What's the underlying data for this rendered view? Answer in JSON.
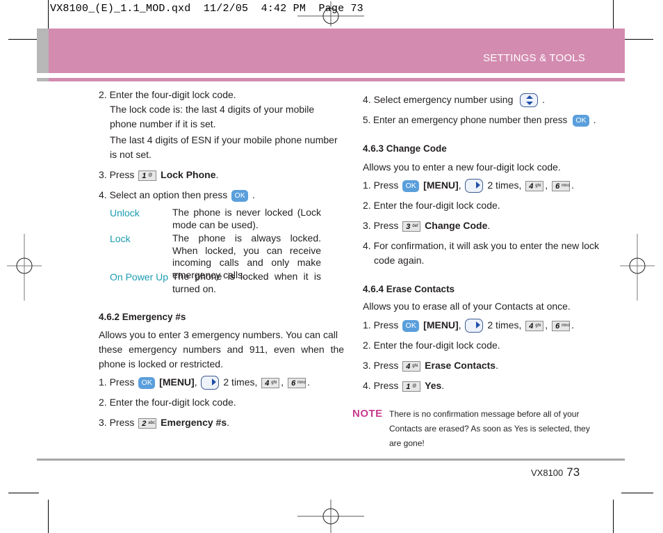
{
  "slug": "VX8100_(E)_1.1_MOD.qxd  11/2/05  4:42 PM  Page 73",
  "header": {
    "section_title": "SETTINGS & TOOLS",
    "accent_color": "#d38bb0",
    "sidebar_color": "#b8b7b7"
  },
  "left": {
    "step2": {
      "num": "2.",
      "text": "Enter the four-digit lock code.",
      "note1a": "The lock code is: the last 4 digits of your mobile",
      "note1b": "phone number if it is set.",
      "note2a": "The last 4 digits of ESN if your mobile phone number",
      "note2b": "is not set."
    },
    "step3": {
      "num": "3.",
      "press": "Press",
      "key": "1",
      "key_sub": "@",
      "label": "Lock Phone",
      "end": "."
    },
    "step4": {
      "num": "4.",
      "text": "Select an option then press",
      "ok": "OK",
      "end": "."
    },
    "options": [
      {
        "name": "Unlock",
        "desc": "The phone is never locked (Lock mode can be used)."
      },
      {
        "name": "Lock",
        "desc": "The phone is always locked. When locked, you can receive incoming calls and only make emergency calls."
      },
      {
        "name": "On Power Up",
        "desc": "The phone is locked when it is turned on."
      }
    ],
    "section": {
      "heading": "4.6.2 Emergency #s",
      "intro1": "Allows you to enter 3 emergency numbers. You can call",
      "intro2": "these emergency numbers and 911, even when the",
      "intro3": "phone is locked or restricted.",
      "s1": {
        "num": "1.",
        "press": "Press",
        "ok": "OK",
        "menu": "[MENU]",
        "comma": ",",
        "times": "2 times,",
        "k1": "4",
        "k1s": "ghi",
        "k2": "6",
        "k2s": "mno",
        "end": "."
      },
      "s2": {
        "num": "2.",
        "text": "Enter the four-digit lock code."
      },
      "s3": {
        "num": "3.",
        "press": "Press",
        "key": "2",
        "key_sub": "abc",
        "label": "Emergency #s",
        "end": "."
      }
    }
  },
  "right": {
    "s4": {
      "num": "4.",
      "text": "Select emergency number using",
      "end": "."
    },
    "s5": {
      "num": "5.",
      "text": "Enter an emergency phone number then press",
      "ok": "OK",
      "end": "."
    },
    "change": {
      "heading": "4.6.3 Change Code",
      "intro": "Allows you to enter a new four-digit lock code.",
      "s1": {
        "num": "1.",
        "press": "Press",
        "ok": "OK",
        "menu": "[MENU]",
        "comma": ",",
        "times": "2 times,",
        "k1": "4",
        "k1s": "ghi",
        "k2": "6",
        "k2s": "mno",
        "end": "."
      },
      "s2": {
        "num": "2.",
        "text": "Enter the four-digit lock code."
      },
      "s3": {
        "num": "3.",
        "press": "Press",
        "key": "3",
        "key_sub": "def",
        "label": "Change Code",
        "end": "."
      },
      "s4": {
        "num": "4.",
        "text1": "For confirmation, it will ask you to enter the new lock",
        "text2": "code again."
      }
    },
    "erase": {
      "heading": "4.6.4 Erase Contacts",
      "intro": "Allows you to erase all of your Contacts at once.",
      "s1": {
        "num": "1.",
        "press": "Press",
        "ok": "OK",
        "menu": "[MENU]",
        "comma": ",",
        "times": "2 times,",
        "k1": "4",
        "k1s": "ghi",
        "k2": "6",
        "k2s": "mno",
        "end": "."
      },
      "s2": {
        "num": "2.",
        "text": "Enter the four-digit lock code."
      },
      "s3": {
        "num": "3.",
        "press": "Press",
        "key": "4",
        "key_sub": "ghi",
        "label": "Erase Contacts",
        "end": "."
      },
      "s4": {
        "num": "4.",
        "press": "Press",
        "key": "1",
        "key_sub": "@",
        "label": "Yes",
        "end": "."
      }
    },
    "note": {
      "label": "NOTE",
      "line1": "There is no confirmation message before all of your",
      "line2": "Contacts are erased? As soon as Yes is selected, they",
      "line3": "are gone!"
    }
  },
  "footer": {
    "model": "VX8100",
    "page": "73"
  }
}
